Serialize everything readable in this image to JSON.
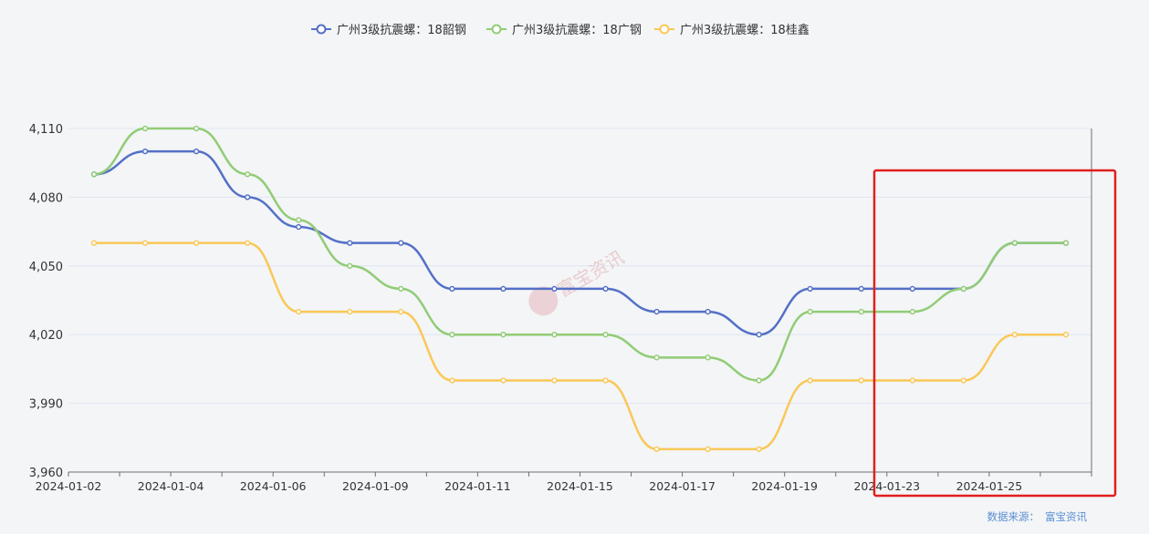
{
  "chart_data": {
    "type": "line",
    "x": [
      "2024-01-02",
      "2024-01-03",
      "2024-01-04",
      "2024-01-05",
      "2024-01-06",
      "2024-01-08",
      "2024-01-09",
      "2024-01-10",
      "2024-01-11",
      "2024-01-12",
      "2024-01-15",
      "2024-01-16",
      "2024-01-17",
      "2024-01-18",
      "2024-01-19",
      "2024-01-22",
      "2024-01-23",
      "2024-01-24",
      "2024-01-25",
      "2024-01-26"
    ],
    "x_tick_labels": [
      "2024-01-02",
      "2024-01-04",
      "2024-01-06",
      "2024-01-09",
      "2024-01-11",
      "2024-01-15",
      "2024-01-17",
      "2024-01-19",
      "2024-01-23",
      "2024-01-25"
    ],
    "y_ticks": [
      "3,960",
      "3,990",
      "4,020",
      "4,050",
      "4,080",
      "4,110"
    ],
    "ylim": [
      3960,
      4110
    ],
    "grid": true,
    "legend_position": "top-center",
    "series": [
      {
        "name": "广州3级抗震螺：18韶钢",
        "color": "#5470c6",
        "values": [
          4090,
          4100,
          4100,
          4080,
          4067,
          4060,
          4060,
          4040,
          4040,
          4040,
          4040,
          4030,
          4030,
          4020,
          4040,
          4040,
          4040,
          4040,
          4060,
          4060
        ]
      },
      {
        "name": "广州3级抗震螺：18广钢",
        "color": "#91cc75",
        "values": [
          4090,
          4110,
          4110,
          4090,
          4070,
          4050,
          4040,
          4020,
          4020,
          4020,
          4020,
          4010,
          4010,
          4000,
          4030,
          4030,
          4030,
          4040,
          4060,
          4060
        ]
      },
      {
        "name": "广州3级抗震螺：18桂鑫",
        "color": "#fac858",
        "values": [
          4060,
          4060,
          4060,
          4060,
          4030,
          4030,
          4030,
          4000,
          4000,
          4000,
          4000,
          3970,
          3970,
          3970,
          4000,
          4000,
          4000,
          4000,
          4020,
          4020
        ]
      }
    ],
    "highlight_box_color": "#e0201e"
  },
  "watermark": {
    "text": "富宝资讯"
  },
  "footnote": {
    "label": "数据来源：",
    "source": "富宝资讯"
  }
}
